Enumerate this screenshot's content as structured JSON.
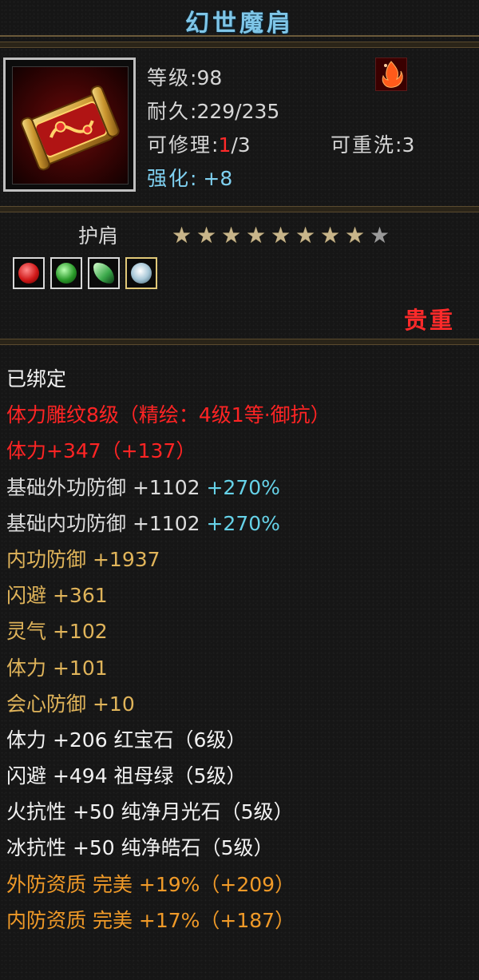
{
  "item": {
    "name": "幻世魔肩",
    "level_label": "等级",
    "level_value": "98",
    "durability_label": "耐久",
    "durability_value": "229/235",
    "repair_label": "可修理",
    "repair_used": "1",
    "repair_total": "/3",
    "rewash_label": "可重洗",
    "rewash_value": "3",
    "enhance_label": "强化",
    "enhance_value": "+8",
    "slot": "护肩",
    "stars_filled": 8,
    "stars_total": 9,
    "rarity": "贵重",
    "gem_icons": [
      "red-gem-icon",
      "green-gem-icon",
      "green-gem-icon",
      "silver-gem-icon"
    ]
  },
  "attributes": [
    {
      "id": "bound",
      "parts": [
        {
          "t": "已绑定",
          "c": "white"
        }
      ]
    },
    {
      "id": "engrave",
      "parts": [
        {
          "t": "体力雕纹8级（精绘：4级1等·御抗）",
          "c": "red"
        }
      ]
    },
    {
      "id": "stamina-main",
      "parts": [
        {
          "t": "体力+347（+137）",
          "c": "red"
        }
      ]
    },
    {
      "id": "base-outer-def",
      "parts": [
        {
          "t": "基础外功防御 +1102",
          "c": "light"
        },
        {
          "t": " +270%",
          "c": "cyan"
        }
      ]
    },
    {
      "id": "base-inner-def",
      "parts": [
        {
          "t": "基础内功防御 +1102",
          "c": "light"
        },
        {
          "t": " +270%",
          "c": "cyan"
        }
      ]
    },
    {
      "id": "inner-def",
      "parts": [
        {
          "t": "内功防御",
          "c": "gold"
        },
        {
          "t": " +1937",
          "c": "gold"
        }
      ]
    },
    {
      "id": "dodge",
      "parts": [
        {
          "t": "闪避",
          "c": "gold"
        },
        {
          "t": " +361",
          "c": "gold"
        }
      ]
    },
    {
      "id": "spirit",
      "parts": [
        {
          "t": "灵气",
          "c": "gold"
        },
        {
          "t": " +102",
          "c": "gold"
        }
      ]
    },
    {
      "id": "stamina",
      "parts": [
        {
          "t": "体力",
          "c": "gold"
        },
        {
          "t": " +101",
          "c": "gold"
        }
      ]
    },
    {
      "id": "crit-def",
      "parts": [
        {
          "t": "会心防御",
          "c": "gold"
        },
        {
          "t": " +10",
          "c": "gold"
        }
      ]
    },
    {
      "id": "gem-stamina",
      "parts": [
        {
          "t": "体力 +206 红宝石（6级）",
          "c": "white"
        }
      ]
    },
    {
      "id": "gem-dodge",
      "parts": [
        {
          "t": "闪避 +494 祖母绿（5级）",
          "c": "white"
        }
      ]
    },
    {
      "id": "gem-fire",
      "parts": [
        {
          "t": "火抗性 +50 纯净月光石（5级）",
          "c": "white"
        }
      ]
    },
    {
      "id": "gem-ice",
      "parts": [
        {
          "t": "冰抗性 +50 纯净皓石（5级）",
          "c": "white"
        }
      ]
    },
    {
      "id": "outer-quality",
      "parts": [
        {
          "t": "外防资质",
          "c": "orange"
        },
        {
          "t": "  完美 +19%（+209）",
          "c": "orange"
        }
      ]
    },
    {
      "id": "inner-quality",
      "parts": [
        {
          "t": "内防资质",
          "c": "orange"
        },
        {
          "t": "  完美 +17%（+187）",
          "c": "orange"
        }
      ]
    }
  ],
  "colors": {
    "title": "#7fc6e8",
    "rarity": "#ff2a2a",
    "gold": "#e0b45a",
    "orange": "#f09a28",
    "cyan": "#66d2e8"
  }
}
